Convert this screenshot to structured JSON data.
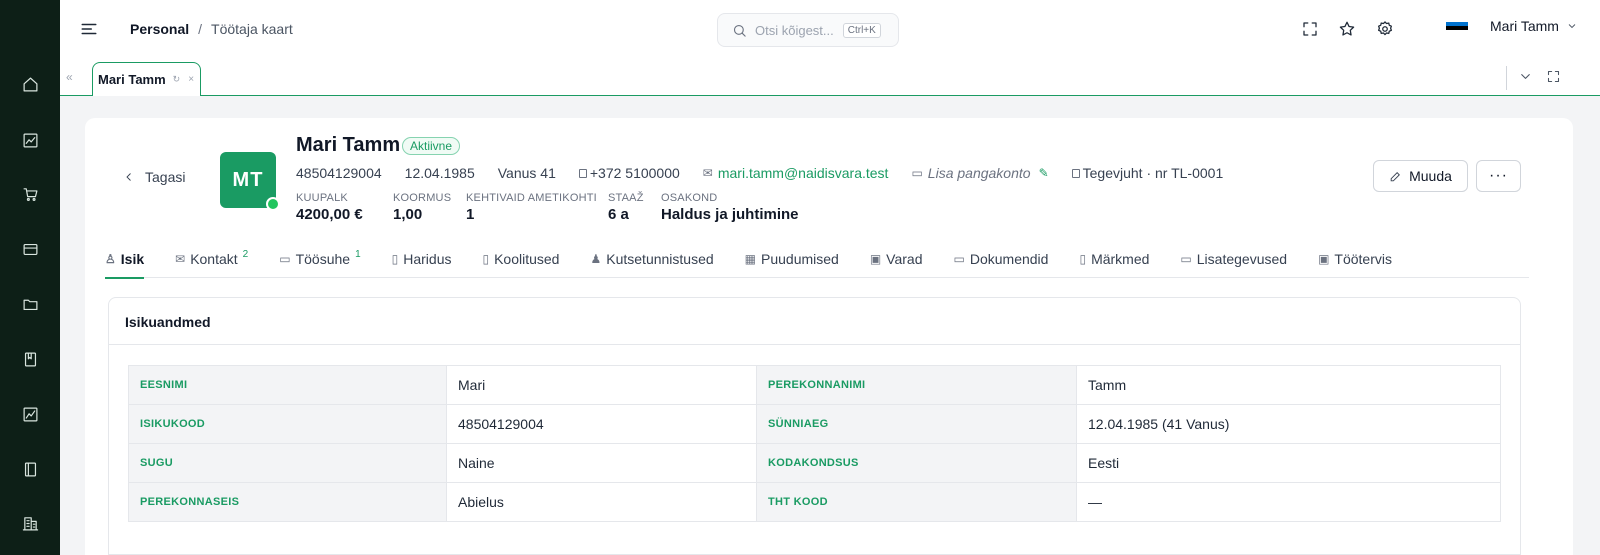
{
  "sidebar": {
    "items": [
      {
        "icon": "home-icon"
      },
      {
        "icon": "chart-icon"
      },
      {
        "icon": "cart-icon"
      },
      {
        "icon": "card-icon"
      },
      {
        "icon": "folder-icon"
      },
      {
        "icon": "book-icon"
      },
      {
        "icon": "analytics-icon"
      },
      {
        "icon": "notebook-icon"
      },
      {
        "icon": "building-icon"
      }
    ]
  },
  "header": {
    "breadcrumb": {
      "root": "Personal",
      "separator": "/",
      "current": "Töötaja kaart"
    },
    "search": {
      "placeholder": "Otsi kõigest...",
      "shortcut": "Ctrl+K"
    },
    "user_name": "Mari Tamm",
    "flag_colors": [
      "#0072ce",
      "#000000",
      "#ffffff"
    ]
  },
  "tab_strip": {
    "tabs": [
      {
        "label": "Mari Tamm"
      }
    ],
    "refresh_glyph": "↻",
    "close_glyph": "×",
    "left_arrow": "«"
  },
  "employee": {
    "back_label": "Tagasi",
    "initials": "MT",
    "name": "Mari Tamm",
    "status": "Aktiivne",
    "id_code": "48504129004",
    "birth_date": "12.04.1985",
    "age": "Vanus 41",
    "phone": "+372 5100000",
    "email": "mari.tamm@naidisvara.test",
    "bank_account": "Lisa pangakonto",
    "position": "Tegevjuht · nr TL-0001",
    "stats": [
      {
        "label": "KUUPALK",
        "value": "4200,00 €"
      },
      {
        "label": "KOORMUS",
        "value": "1,00"
      },
      {
        "label": "KEHTIVAID AMETIKOHTI",
        "value": "1"
      },
      {
        "label": "STAAŽ",
        "value": "6 a"
      },
      {
        "label": "OSAKOND",
        "value": "Haldus ja juhtimine"
      }
    ],
    "edit_label": "Muuda",
    "more_label": "···"
  },
  "tabs": [
    {
      "label": "Isik",
      "icon": "person-icon",
      "glyph": "♙",
      "active": true,
      "count": ""
    },
    {
      "label": "Kontakt",
      "icon": "mail-icon",
      "glyph": "✉",
      "active": false,
      "count": "2"
    },
    {
      "label": "Töösuhe",
      "icon": "briefcase-icon",
      "glyph": "▭",
      "active": false,
      "count": "1"
    },
    {
      "label": "Haridus",
      "icon": "school-icon",
      "glyph": "▯",
      "active": false,
      "count": ""
    },
    {
      "label": "Koolitused",
      "icon": "book-icon",
      "glyph": "▯",
      "active": false,
      "count": ""
    },
    {
      "label": "Kutsetunnistused",
      "icon": "certificate-icon",
      "glyph": "♟",
      "active": false,
      "count": ""
    },
    {
      "label": "Puudumised",
      "icon": "calendar-icon",
      "glyph": "▦",
      "active": false,
      "count": ""
    },
    {
      "label": "Varad",
      "icon": "assets-icon",
      "glyph": "▣",
      "active": false,
      "count": ""
    },
    {
      "label": "Dokumendid",
      "icon": "folder-icon",
      "glyph": "▭",
      "active": false,
      "count": ""
    },
    {
      "label": "Märkmed",
      "icon": "notes-icon",
      "glyph": "▯",
      "active": false,
      "count": ""
    },
    {
      "label": "Lisategevused",
      "icon": "folder-open-icon",
      "glyph": "▭",
      "active": false,
      "count": ""
    },
    {
      "label": "Töötervis",
      "icon": "health-icon",
      "glyph": "▣",
      "active": false,
      "count": ""
    }
  ],
  "personal_section": {
    "title": "Isikuandmed",
    "rows": [
      [
        {
          "label": "EESNIMI",
          "value": "Mari"
        },
        {
          "label": "PEREKONNANIMI",
          "value": "Tamm"
        }
      ],
      [
        {
          "label": "ISIKUKOOD",
          "value": "48504129004"
        },
        {
          "label": "SÜNNIAEG",
          "value": "12.04.1985 (41 Vanus)"
        }
      ],
      [
        {
          "label": "SUGU",
          "value": "Naine"
        },
        {
          "label": "KODAKONDSUS",
          "value": "Eesti"
        }
      ],
      [
        {
          "label": "PEREKONNASEIS",
          "value": "Abielus"
        },
        {
          "label": "THT KOOD",
          "value": "—"
        }
      ]
    ]
  },
  "colors": {
    "accent": "#1a9b63",
    "sidebar": "#0d1f17"
  }
}
